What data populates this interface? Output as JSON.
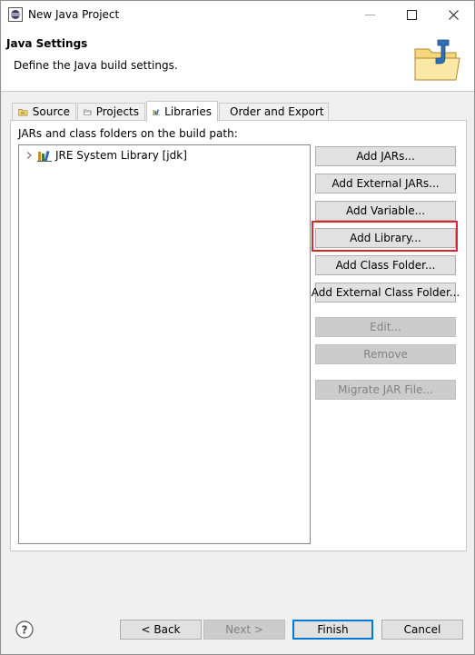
{
  "window": {
    "title": "New Java Project",
    "controls": {
      "minimize": "—",
      "maximize": "☐",
      "close": "✕"
    }
  },
  "header": {
    "title": "Java Settings",
    "description": "Define the Java build settings.",
    "icon": "java-project-folder-icon"
  },
  "tabs": [
    {
      "label": "Source",
      "icon": "source-folder-icon",
      "active": false
    },
    {
      "label": "Projects",
      "icon": "projects-folder-icon",
      "active": false
    },
    {
      "label": "Libraries",
      "icon": "libraries-icon",
      "active": true
    },
    {
      "label": "Order and Export",
      "icon": "order-export-icon",
      "active": false
    }
  ],
  "libraries": {
    "label": "JARs and class folders on the build path:",
    "tree": [
      {
        "label": "JRE System Library [jdk]",
        "icon": "library-icon",
        "expanded": false
      }
    ],
    "buttons": [
      {
        "label": "Add JARs...",
        "enabled": true
      },
      {
        "label": "Add External JARs...",
        "enabled": true
      },
      {
        "label": "Add Variable...",
        "enabled": true
      },
      {
        "label": "Add Library...",
        "enabled": true,
        "highlighted": true
      },
      {
        "label": "Add Class Folder...",
        "enabled": true
      },
      {
        "label": "Add External Class Folder...",
        "enabled": true
      },
      {
        "label": "Edit...",
        "enabled": false
      },
      {
        "label": "Remove",
        "enabled": false
      },
      {
        "label": "Migrate JAR File...",
        "enabled": false
      }
    ]
  },
  "footer": {
    "help_icon": "help-icon",
    "back": "< Back",
    "next": "Next >",
    "finish": "Finish",
    "cancel": "Cancel"
  },
  "colors": {
    "highlight": "#e0262d",
    "default_button_border": "#0078d7",
    "dialog_background": "#f0f0f0"
  }
}
